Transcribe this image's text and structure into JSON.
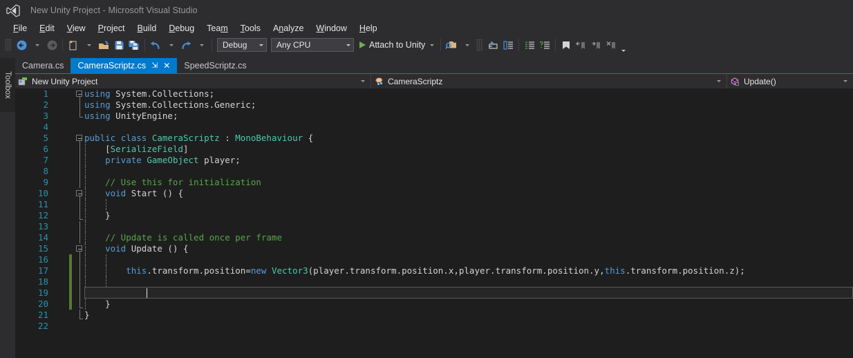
{
  "window": {
    "title": "New Unity Project - Microsoft Visual Studio",
    "logo_icon": "visual-studio-logo-icon"
  },
  "menubar": {
    "items": [
      {
        "label": "File",
        "accel": "F"
      },
      {
        "label": "Edit",
        "accel": "E"
      },
      {
        "label": "View",
        "accel": "V"
      },
      {
        "label": "Project",
        "accel": "P"
      },
      {
        "label": "Build",
        "accel": "B"
      },
      {
        "label": "Debug",
        "accel": "D"
      },
      {
        "label": "Team",
        "accel": "m"
      },
      {
        "label": "Tools",
        "accel": "T"
      },
      {
        "label": "Analyze",
        "accel": "A"
      },
      {
        "label": "Window",
        "accel": "W"
      },
      {
        "label": "Help",
        "accel": "H"
      }
    ]
  },
  "toolbar": {
    "icons": [
      "navigate-backward-icon",
      "navigate-forward-icon",
      "new-item-icon",
      "open-file-icon",
      "save-icon",
      "save-all-icon",
      "undo-icon",
      "redo-icon"
    ],
    "config_combo": {
      "value": "Debug"
    },
    "platform_combo": {
      "value": "Any CPU"
    },
    "attach_button": {
      "label": "Attach to Unity",
      "icon": "play-triangle-icon",
      "color": "#6AAF56"
    },
    "right_icons": [
      "find-in-files-icon",
      "step-into-specific-icon",
      "show-next-statement-icon",
      "comment-selection-icon",
      "uncomment-selection-icon",
      "toggle-bookmark-icon",
      "previous-bookmark-icon",
      "next-bookmark-icon",
      "clear-bookmarks-icon"
    ],
    "overflow_icon": "toolbar-overflow-chevron-icon"
  },
  "toolbox": {
    "label": "Toolbox"
  },
  "tabs": {
    "items": [
      {
        "label": "Camera.cs",
        "active": false
      },
      {
        "label": "CameraScriptz.cs",
        "active": true,
        "pin_glyph": "⇲",
        "close_glyph": "✕"
      },
      {
        "label": "SpeedScriptz.cs",
        "active": false
      }
    ],
    "active_color": "#007ACC"
  },
  "navbar": {
    "project": {
      "label": "New Unity Project",
      "icon": "project-icon"
    },
    "class": {
      "label": "CameraScriptz",
      "icon": "class-icon"
    },
    "member": {
      "label": "Update()",
      "icon": "method-icon"
    }
  },
  "editor": {
    "background": "#1E1E1E",
    "line_number_color": "#2B91AF",
    "current_line": 19,
    "caret_column": 13,
    "lines": [
      {
        "n": 1,
        "indent": 0,
        "fold": "start",
        "tokens": [
          {
            "t": "using",
            "c": "k"
          },
          {
            "t": " System.Collections;",
            "c": "s"
          }
        ]
      },
      {
        "n": 2,
        "indent": 0,
        "tokens": [
          {
            "t": "using",
            "c": "k"
          },
          {
            "t": " System.Collections.Generic;",
            "c": "s"
          }
        ]
      },
      {
        "n": 3,
        "indent": 0,
        "tokens": [
          {
            "t": "using",
            "c": "k"
          },
          {
            "t": " UnityEngine;",
            "c": "s"
          }
        ]
      },
      {
        "n": 4,
        "indent": 0,
        "tokens": []
      },
      {
        "n": 5,
        "indent": 0,
        "fold": "start",
        "tokens": [
          {
            "t": "public",
            "c": "k"
          },
          {
            "t": " ",
            "c": "s"
          },
          {
            "t": "class",
            "c": "k"
          },
          {
            "t": " ",
            "c": "s"
          },
          {
            "t": "CameraScriptz",
            "c": "t"
          },
          {
            "t": " : ",
            "c": "s"
          },
          {
            "t": "MonoBehaviour",
            "c": "t"
          },
          {
            "t": " {",
            "c": "s"
          }
        ]
      },
      {
        "n": 6,
        "indent": 1,
        "tokens": [
          {
            "t": "    [",
            "c": "s"
          },
          {
            "t": "SerializeField",
            "c": "t"
          },
          {
            "t": "]",
            "c": "s"
          }
        ]
      },
      {
        "n": 7,
        "indent": 1,
        "tokens": [
          {
            "t": "    ",
            "c": "s"
          },
          {
            "t": "private",
            "c": "k"
          },
          {
            "t": " ",
            "c": "s"
          },
          {
            "t": "GameObject",
            "c": "t"
          },
          {
            "t": " player;",
            "c": "s"
          }
        ]
      },
      {
        "n": 8,
        "indent": 1,
        "tokens": []
      },
      {
        "n": 9,
        "indent": 1,
        "tokens": [
          {
            "t": "    // Use this for initialization",
            "c": "c"
          }
        ]
      },
      {
        "n": 10,
        "indent": 1,
        "fold": "start",
        "tokens": [
          {
            "t": "    ",
            "c": "s"
          },
          {
            "t": "void",
            "c": "k"
          },
          {
            "t": " ",
            "c": "s"
          },
          {
            "t": "Start",
            "c": "m"
          },
          {
            "t": " () {",
            "c": "s"
          }
        ]
      },
      {
        "n": 11,
        "indent": 2,
        "tokens": []
      },
      {
        "n": 12,
        "indent": 1,
        "fold": "end",
        "tokens": [
          {
            "t": "    }",
            "c": "s"
          }
        ]
      },
      {
        "n": 13,
        "indent": 1,
        "tokens": []
      },
      {
        "n": 14,
        "indent": 1,
        "tokens": [
          {
            "t": "    // Update is called once per frame",
            "c": "c"
          }
        ]
      },
      {
        "n": 15,
        "indent": 1,
        "fold": "start",
        "tokens": [
          {
            "t": "    ",
            "c": "s"
          },
          {
            "t": "void",
            "c": "k"
          },
          {
            "t": " ",
            "c": "s"
          },
          {
            "t": "Update",
            "c": "m"
          },
          {
            "t": " () {",
            "c": "s"
          }
        ]
      },
      {
        "n": 16,
        "indent": 2,
        "changed": true,
        "tokens": []
      },
      {
        "n": 17,
        "indent": 2,
        "changed": true,
        "tokens": [
          {
            "t": "        ",
            "c": "s"
          },
          {
            "t": "this",
            "c": "k"
          },
          {
            "t": ".transform.position=",
            "c": "s"
          },
          {
            "t": "new",
            "c": "k"
          },
          {
            "t": " ",
            "c": "s"
          },
          {
            "t": "Vector3",
            "c": "t"
          },
          {
            "t": "(player.transform.position.x,player.transform.position.y,",
            "c": "s"
          },
          {
            "t": "this",
            "c": "k"
          },
          {
            "t": ".transform.position.z);",
            "c": "s"
          }
        ]
      },
      {
        "n": 18,
        "indent": 2,
        "changed": true,
        "tokens": []
      },
      {
        "n": 19,
        "indent": 2,
        "changed": true,
        "current": true,
        "tokens": []
      },
      {
        "n": 20,
        "indent": 1,
        "changed": true,
        "fold": "end",
        "tokens": [
          {
            "t": "    }",
            "c": "s"
          }
        ]
      },
      {
        "n": 21,
        "indent": 0,
        "fold": "end",
        "tokens": [
          {
            "t": "}",
            "c": "s"
          }
        ]
      },
      {
        "n": 22,
        "indent": 0,
        "tokens": []
      }
    ]
  },
  "colors": {
    "chrome": "#2D2D30",
    "editor_bg": "#1E1E1E",
    "accent": "#007ACC",
    "keyword": "#569CD6",
    "type": "#4EC9B0",
    "comment": "#57A64A",
    "plain": "#D4D4D4",
    "change_bar": "#57792E"
  }
}
